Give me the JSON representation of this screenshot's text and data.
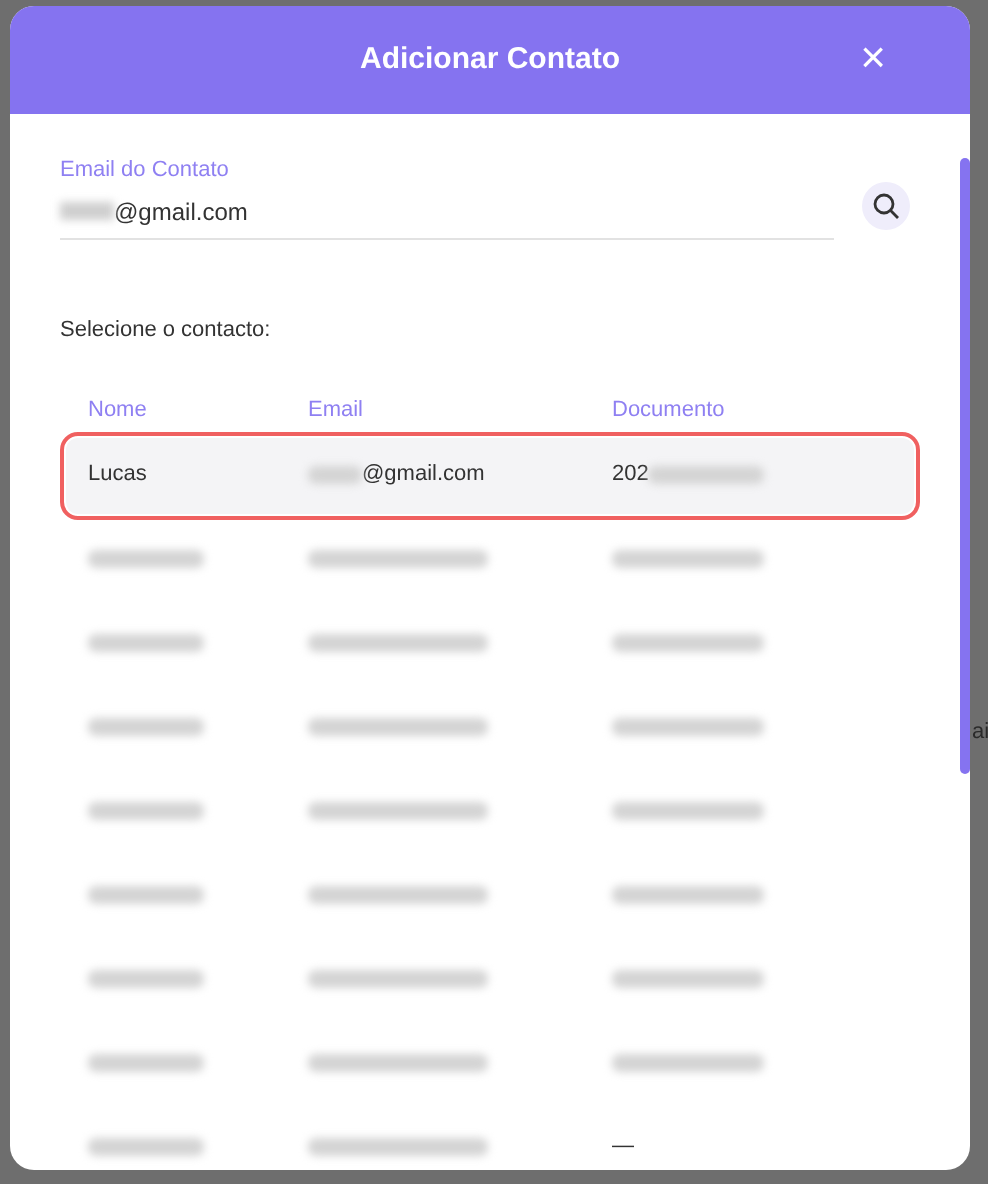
{
  "dialog": {
    "title": "Adicionar Contato",
    "close": "×"
  },
  "email_field": {
    "label": "Email do Contato",
    "value": "@gmail.com"
  },
  "prompt": "Selecione o contacto:",
  "table": {
    "columns": [
      "Nome",
      "Email",
      "Documento"
    ],
    "rows": [
      {
        "kind": "partial",
        "name": "Lucas",
        "email": "@gmail.com",
        "document": "202",
        "selected": true
      },
      {
        "kind": "blurred",
        "selected": false
      },
      {
        "kind": "blurred",
        "selected": false
      },
      {
        "kind": "blurred",
        "selected": false
      },
      {
        "kind": "blurred",
        "selected": false
      },
      {
        "kind": "blurred",
        "selected": false
      },
      {
        "kind": "blurred",
        "selected": false
      },
      {
        "kind": "blurred",
        "selected": false
      },
      {
        "kind": "blurred",
        "selected": false,
        "document": "—"
      }
    ]
  },
  "backdrop_text": "ai"
}
